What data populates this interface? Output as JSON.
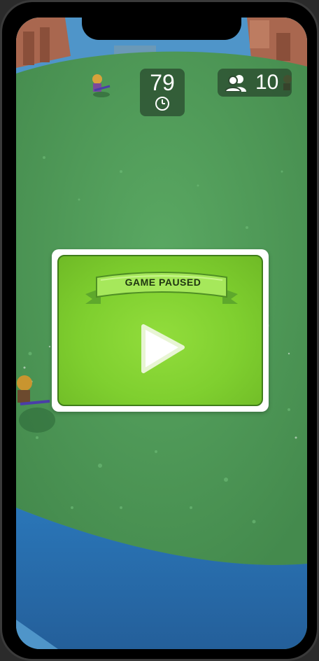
{
  "hud": {
    "timer_value": "79",
    "timer_icon": "clock-icon",
    "players_icon": "people-icon",
    "players_count": "10"
  },
  "pause_dialog": {
    "title": "GAME PAUSED",
    "play_icon": "play-icon"
  },
  "colors": {
    "grass": "#4f9b57",
    "water": "#2a6fb0",
    "panel_green": "#84d234",
    "hud_bg": "#2d4a30"
  }
}
